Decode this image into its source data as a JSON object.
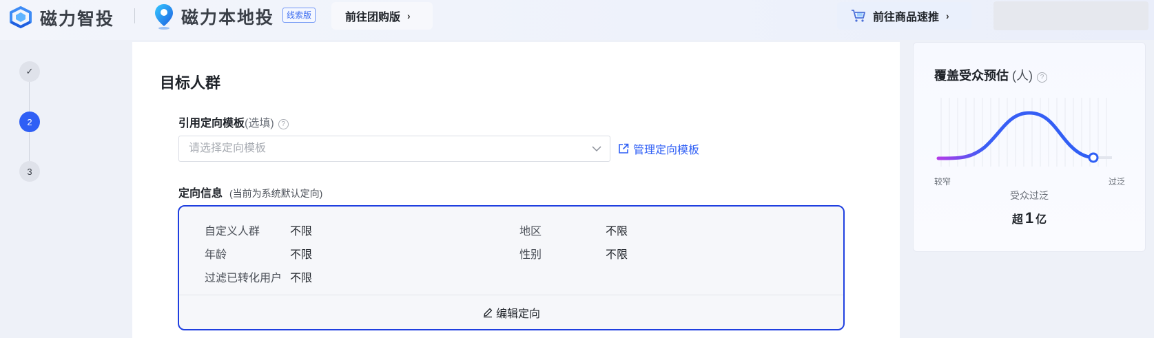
{
  "header": {
    "brand_primary": "磁力智投",
    "brand_secondary": "磁力本地投",
    "brand_tag": "线索版",
    "group_buy_button": "前往团购版",
    "goods_button": "前往商品速推"
  },
  "steps": [
    "✓",
    "2",
    "3"
  ],
  "section": {
    "title": "目标人群",
    "template_label": "引用定向模板",
    "template_optional": "(选填)",
    "template_placeholder": "请选择定向模板",
    "manage_link": "管理定向模板",
    "info_label": "定向信息",
    "info_note": "(当前为系统默认定向)",
    "targeting": [
      {
        "key": "自定义人群",
        "value": "不限"
      },
      {
        "key": "地区",
        "value": "不限"
      },
      {
        "key": "年龄",
        "value": "不限"
      },
      {
        "key": "性别",
        "value": "不限"
      },
      {
        "key": "过滤已转化用户",
        "value": "不限"
      }
    ],
    "edit_button": "编辑定向"
  },
  "estimate": {
    "title": "覆盖受众预估",
    "unit": "(人)",
    "label_narrow": "较窄",
    "label_broad": "过泛",
    "status": "受众过泛",
    "count_prefix": "超",
    "count_number": "1",
    "count_suffix": "亿",
    "level": 0.95
  },
  "colors": {
    "primary": "#2f5ff5",
    "border_active": "#1f3fe0",
    "curve_start": "#8a2be2",
    "curve_end": "#2f5ff5"
  }
}
